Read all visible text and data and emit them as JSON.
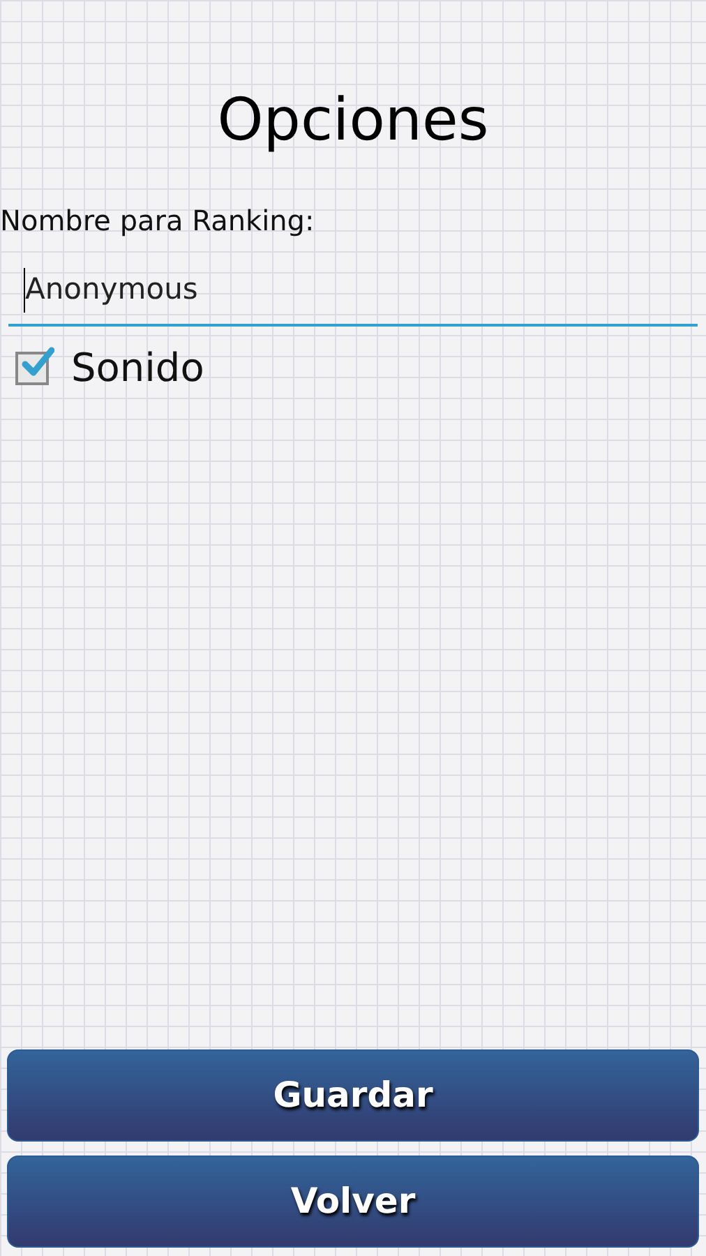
{
  "title": "Opciones",
  "name_field": {
    "label": "Nombre para Ranking:",
    "value": "Anonymous",
    "focused": true
  },
  "sound": {
    "label": "Sonido",
    "checked": true
  },
  "buttons": [
    {
      "label": "Guardar"
    },
    {
      "label": "Volver"
    }
  ]
}
